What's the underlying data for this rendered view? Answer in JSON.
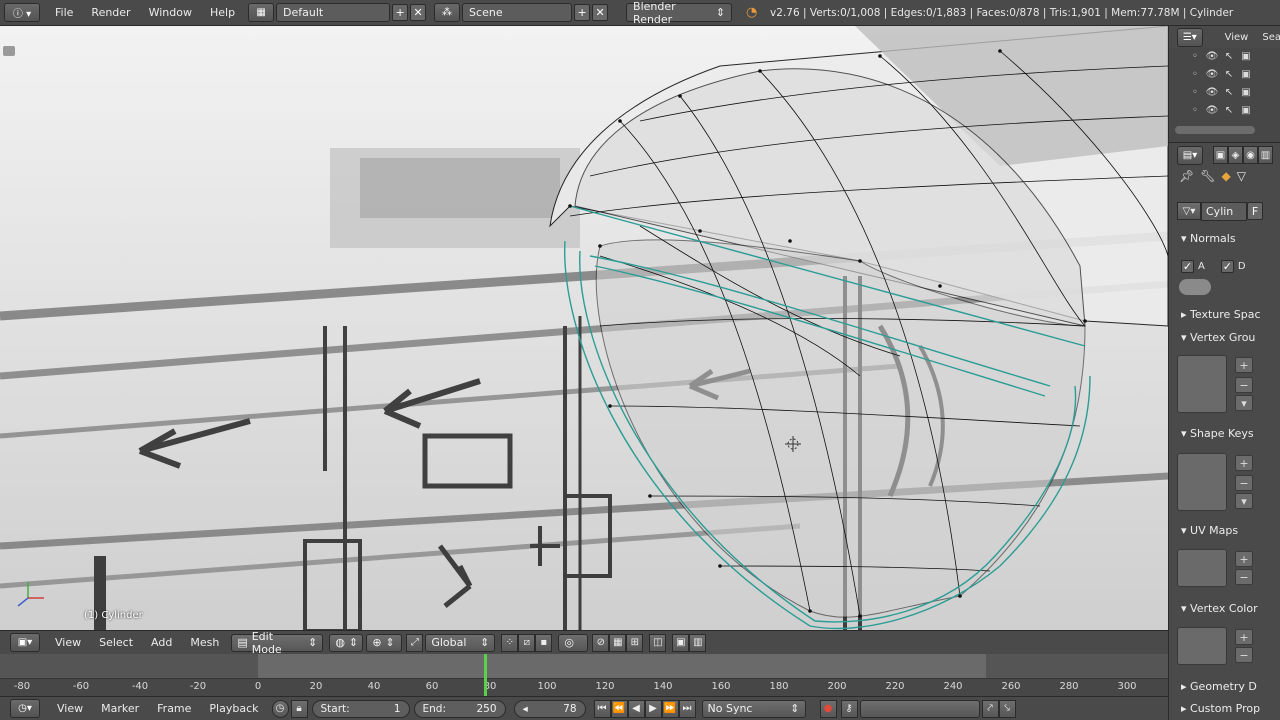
{
  "topbar": {
    "menus": [
      "File",
      "Render",
      "Window",
      "Help"
    ],
    "screen_layout": "Default",
    "scene": "Scene",
    "render_engine": "Blender Render",
    "stats": "v2.76 | Verts:0/1,008 | Edges:0/1,883 | Faces:0/878 | Tris:1,901 | Mem:77.78M | Cylinder"
  },
  "viewport": {
    "object_label": "(1) Cylinder"
  },
  "viewport_header": {
    "menus": [
      "View",
      "Select",
      "Add",
      "Mesh"
    ],
    "mode": "Edit Mode",
    "orientation": "Global"
  },
  "timeline": {
    "ticks": [
      "-80",
      "-60",
      "-40",
      "-20",
      "0",
      "20",
      "40",
      "60",
      "80",
      "100",
      "120",
      "140",
      "160",
      "180",
      "200",
      "220",
      "240",
      "260",
      "280",
      "300"
    ],
    "current_frame_indicator": 79
  },
  "timeline_header": {
    "menus": [
      "View",
      "Marker",
      "Frame",
      "Playback"
    ],
    "start_label": "Start:",
    "start_value": "1",
    "end_label": "End:",
    "end_value": "250",
    "current_frame": "78",
    "sync": "No Sync"
  },
  "outliner": {
    "tabs": [
      "View",
      "Sea"
    ]
  },
  "properties": {
    "mesh_name": "Cylin",
    "fake_user": "F",
    "panels": {
      "normals": "Normals",
      "auto_smooth": "A",
      "double_sided": "D",
      "texture_space": "Texture Spac",
      "vertex_groups": "Vertex Grou",
      "shape_keys": "Shape Keys",
      "uv_maps": "UV Maps",
      "vertex_colors": "Vertex Color",
      "geometry": "Geometry D",
      "custom_props": "Custom Prop"
    }
  },
  "colors": {
    "selection_outline": "#2a9d95",
    "current_frame": "#5bd04d",
    "wire": "#111111"
  }
}
